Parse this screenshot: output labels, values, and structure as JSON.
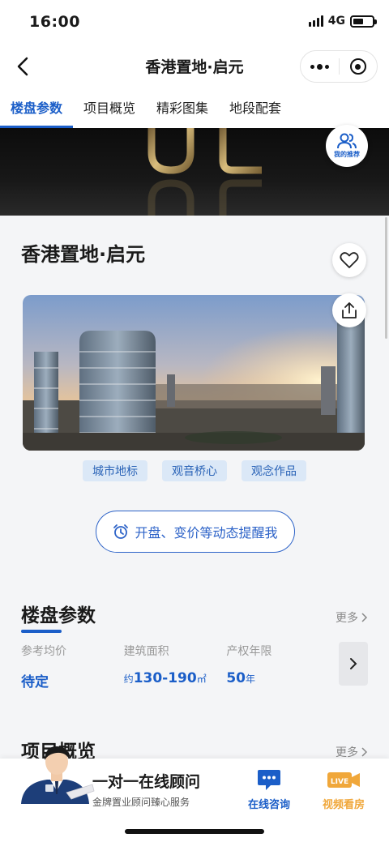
{
  "status_bar": {
    "time": "16:00",
    "network": "4G"
  },
  "nav": {
    "title": "香港置地·启元"
  },
  "tabs": [
    {
      "label": "楼盘参数",
      "active": true
    },
    {
      "label": "项目概览",
      "active": false
    },
    {
      "label": "精彩图集",
      "active": false
    },
    {
      "label": "地段配套",
      "active": false
    }
  ],
  "hero": {
    "recommend_label": "我的推荐"
  },
  "project": {
    "title": "香港置地·启元",
    "tags": [
      "城市地标",
      "观音桥心",
      "观念作品"
    ],
    "remind_label": "开盘、变价等动态提醒我"
  },
  "params_section": {
    "title": "楼盘参数",
    "more": "更多",
    "items": [
      {
        "label": "参考均价",
        "value": "待定",
        "unit": ""
      },
      {
        "label": "建筑面积",
        "prefix": "约",
        "value": "130-190",
        "unit": "㎡"
      },
      {
        "label": "产权年限",
        "value": "50",
        "unit": "年"
      }
    ]
  },
  "overview_section": {
    "title": "项目概览",
    "more": "更多"
  },
  "bottom_bar": {
    "advisor_title": "一对一在线顾问",
    "advisor_subtitle": "金牌置业顾问臻心服务",
    "online_label": "在线咨询",
    "video_label": "视频看房",
    "live_badge": "LIVE",
    "online_color": "#1b5ec8",
    "video_color": "#f0a73a"
  }
}
